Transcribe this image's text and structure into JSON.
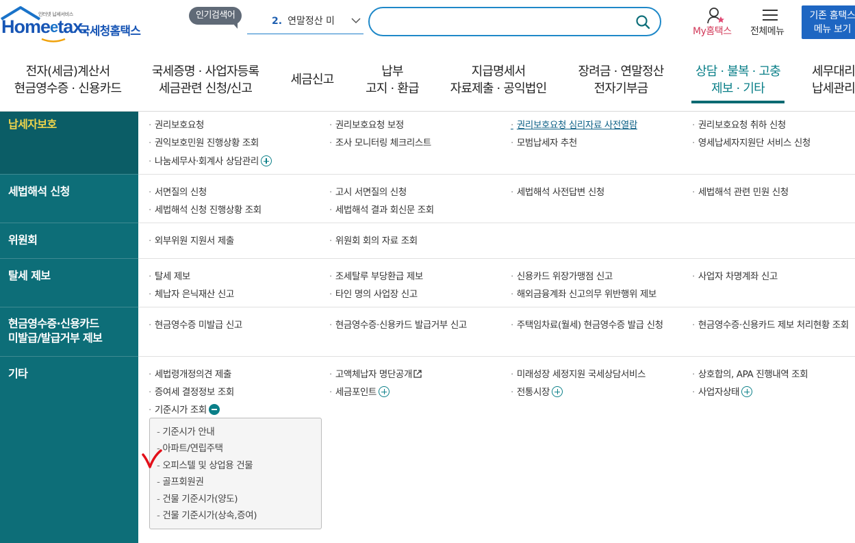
{
  "header": {
    "logo_tagline": "인터넷 납세서비스",
    "logo_home": "Home",
    "logo_e": "e",
    "logo_tax": "tax.",
    "logo_kr": "국세청홈택스",
    "popular_badge": "인기검색어",
    "popular_num": "2.",
    "popular_term": "연말정산 미",
    "search_placeholder": "",
    "my_hometax": "My홈택스",
    "all_menu": "전체메뉴",
    "old_home_line1": "기존 홈택스",
    "old_home_line2": "메뉴 보기"
  },
  "nav": [
    {
      "line1": "전자(세금)계산서",
      "line2": "현금영수증 · 신용카드"
    },
    {
      "line1": "국세증명 · 사업자등록",
      "line2": "세금관련 신청/신고"
    },
    {
      "line1": "세금신고",
      "line2": ""
    },
    {
      "line1": "납부",
      "line2": "고지 · 환급"
    },
    {
      "line1": "지급명세서",
      "line2": "자료제출 · 공익법인"
    },
    {
      "line1": "장려금 · 연말정산",
      "line2": "전자기부금"
    },
    {
      "line1": "상담 · 불복 · 고충",
      "line2": "제보 · 기타"
    },
    {
      "line1": "세무대리",
      "line2": "납세관리"
    }
  ],
  "sections": [
    {
      "title": "납세자보호",
      "items": [
        "권리보호요청",
        "권리보호요청 보정",
        "권리보호요청 심리자료 사전열람",
        "권리보호요청 취하 신청",
        "권익보호민원 진행상황 조회",
        "조사 모니터링 체크리스트",
        "모범납세자 추천",
        "영세납세자지원단 서비스 신청",
        "나눔세무사·회계사 상담관리"
      ]
    },
    {
      "title": "세법해석 신청",
      "items": [
        "서면질의 신청",
        "고시 서면질의 신청",
        "세법해석 사전답변 신청",
        "세법해석 관련 민원 신청",
        "세법해석 신청 진행상황 조회",
        "세법해석 결과 회신문 조회"
      ]
    },
    {
      "title": "위원회",
      "items": [
        "외부위원 지원서 제출",
        "위원회 회의 자료 조회"
      ]
    },
    {
      "title": "탈세 제보",
      "items": [
        "탈세 제보",
        "조세탈루 부당환급 제보",
        "신용카드 위장가맹점 신고",
        "사업자 차명계좌 신고",
        "체납자 은닉재산 신고",
        "타인 명의 사업장 신고",
        "해외금융계좌 신고의무 위반행위 제보"
      ]
    },
    {
      "title_line1": "현금영수증·신용카드",
      "title_line2": "미발급/발급거부 제보",
      "items": [
        "현금영수증 미발급 신고",
        "현금영수증·신용카드 발급거부 신고",
        "주택임차료(월세) 현금영수증 발급 신청",
        "현금영수증·신용카드 제보 처리현황 조회"
      ]
    },
    {
      "title": "기타",
      "items": [
        "세법령개정의견 제출",
        "고액체납자 명단공개",
        "미래성장 세정지원 국세상담서비스",
        "상호합의, APA 진행내역 조회",
        "증여세 결정정보 조회",
        "세금포인트",
        "전통시장",
        "사업자상태",
        "기준시가 조회"
      ]
    }
  ],
  "submenu": [
    "기준시가 안내",
    "아파트/연립주택",
    "오피스텔 및 상업용 건물",
    "골프회원권",
    "건물 기준시가(양도)",
    "건물 기준시가(상속,증여)"
  ],
  "colors": {
    "teal_dark": "#0b5d66",
    "teal": "#0d6e78",
    "accent": "#0a7f88",
    "yellow": "#f1d64b",
    "blue": "#1e66c2"
  }
}
